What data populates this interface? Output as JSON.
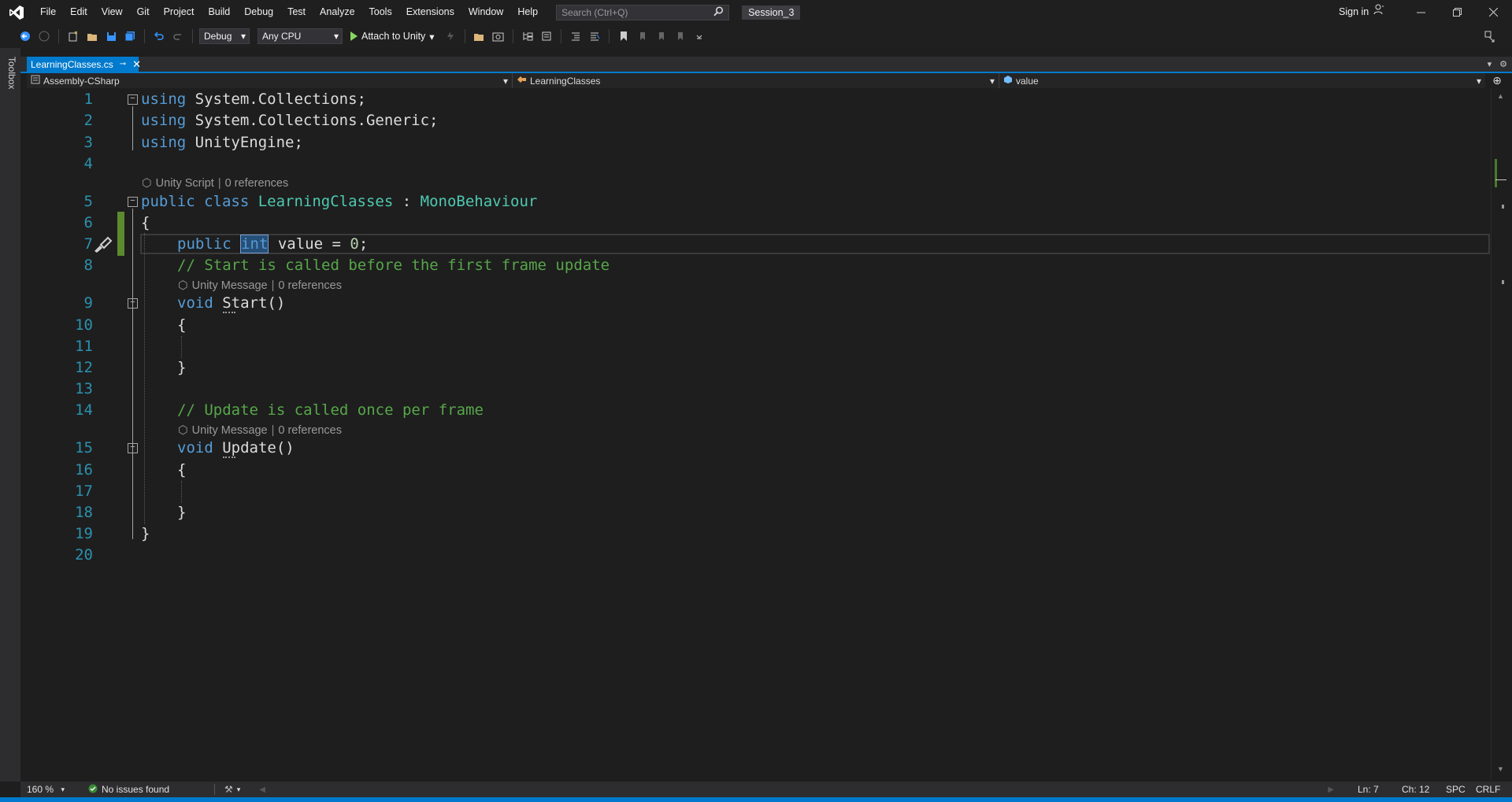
{
  "menu": {
    "items": [
      "File",
      "Edit",
      "View",
      "Git",
      "Project",
      "Build",
      "Debug",
      "Test",
      "Analyze",
      "Tools",
      "Extensions",
      "Window",
      "Help"
    ],
    "search_placeholder": "Search (Ctrl+Q)",
    "solution_name": "Session_3",
    "sign_in": "Sign in"
  },
  "toolbar": {
    "configuration": "Debug",
    "platform": "Any CPU",
    "attach_label": "Attach to Unity"
  },
  "sidebar": {
    "toolbox_label": "Toolbox"
  },
  "tab": {
    "filename": "LearningClasses.cs"
  },
  "navbar": {
    "project": "Assembly-CSharp",
    "type": "LearningClasses",
    "member": "value"
  },
  "codelens": {
    "class_kind": "Unity Script",
    "class_refs": "0 references",
    "start_kind": "Unity Message",
    "start_refs": "0 references",
    "update_kind": "Unity Message",
    "update_refs": "0 references"
  },
  "code": {
    "line_numbers": [
      "1",
      "2",
      "3",
      "4",
      "5",
      "6",
      "7",
      "8",
      "9",
      "10",
      "11",
      "12",
      "13",
      "14",
      "15",
      "16",
      "17",
      "18",
      "19",
      "20"
    ],
    "l1_kw": "using",
    "l1_rest": " System.Collections;",
    "l2_kw": "using",
    "l2_rest": " System.Collections.Generic;",
    "l3_kw": "using",
    "l3_rest": " UnityEngine;",
    "l5_kw1": "public",
    "l5_kw2": " class ",
    "l5_name": "LearningClasses",
    "l5_colon": " : ",
    "l5_base": "MonoBehaviour",
    "brace_open": "{",
    "brace_close": "}",
    "l7_kw": "public",
    "l7_type": "int",
    "l7_rest1": " value = ",
    "l7_num": "0",
    "l7_rest2": ";",
    "l8_comment": "// Start is called before the first frame update",
    "l9_kw": "void",
    "l9_name": " Start()",
    "l14_comment": "// Update is called once per frame",
    "l15_kw": "void",
    "l15_name": " Update()"
  },
  "status": {
    "zoom": "160 %",
    "issues": "No issues found",
    "line": "Ln: 7",
    "char": "Ch: 12",
    "whitespace": "SPC",
    "line_ending": "CRLF"
  },
  "colors": {
    "accent": "#007acc",
    "keyword": "#569cd6",
    "type": "#4ec9b0",
    "comment": "#57a64a",
    "line_number": "#2b91af"
  }
}
